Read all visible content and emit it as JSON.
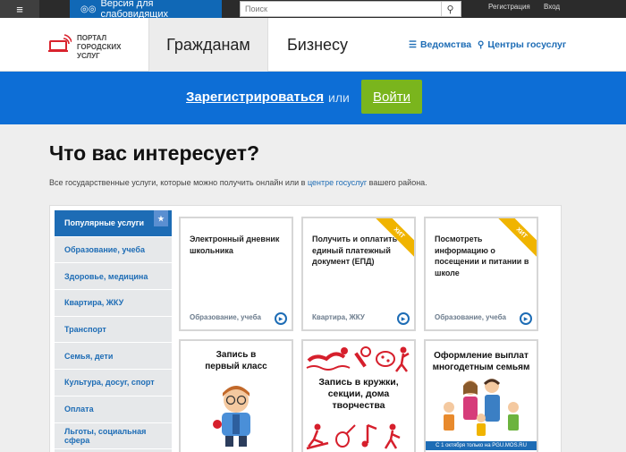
{
  "topbar": {
    "menu_icon": "hamburger-icon",
    "vision_label": "Версия для слабовидящих",
    "vision_icon": "glasses-icon",
    "search_placeholder": "Поиск",
    "search_icon": "search-icon",
    "register_label": "Регистрация",
    "login_label": "Вход"
  },
  "header": {
    "logo_text": "Портал городских услуг",
    "logo_icon": "laptop-wifi-icon",
    "tabs": [
      {
        "label": "Гражданам"
      },
      {
        "label": "Бизнесу"
      }
    ],
    "links": [
      {
        "label": "Ведомства",
        "icon": "list-icon"
      },
      {
        "label": "Центры госуслуг",
        "icon": "location-pin-icon"
      }
    ]
  },
  "band": {
    "register_label": "Зарегистрироваться",
    "or_label": "или",
    "login_button": "Войти"
  },
  "main": {
    "title": "Что вас интересует?",
    "subtitle_before": "Все государственные услуги, которые можно получить онлайн или в ",
    "subtitle_link": "центре госуслуг",
    "subtitle_after": " вашего района."
  },
  "sidebar": {
    "items": [
      {
        "label": "Популярные услуги",
        "badge": "★"
      },
      {
        "label": "Образование, учеба"
      },
      {
        "label": "Здоровье, медицина"
      },
      {
        "label": "Квартира, ЖКУ"
      },
      {
        "label": "Транспорт"
      },
      {
        "label": "Семья, дети"
      },
      {
        "label": "Культура, досуг, спорт"
      },
      {
        "label": "Оплата"
      },
      {
        "label": "Льготы, социальная сфера"
      }
    ]
  },
  "cards": [
    {
      "title": "Электронный дневник школьника",
      "category": "Образование, учеба",
      "ribbon": ""
    },
    {
      "title": "Получить и оплатить единый платежный документ (ЕПД)",
      "category": "Квартира, ЖКУ",
      "ribbon": "ХИТ"
    },
    {
      "title": "Посмотреть информацию о посещении и питании в школе",
      "category": "Образование, учеба",
      "ribbon": "ХИТ"
    }
  ],
  "image_cards": [
    {
      "title": "Запись в первый класс"
    },
    {
      "title": "Запись в кружки, секции, дома творчества"
    },
    {
      "title": "Оформление выплат многодетным семьям",
      "footer": "С 1 октября только на PGU.MOS.RU"
    }
  ],
  "colors": {
    "brand_blue": "#0d6ed6",
    "link_blue": "#1d6cb5",
    "login_green": "#7ab51d",
    "ribbon_yellow": "#f0b400",
    "sport_red": "#d61f2c"
  }
}
